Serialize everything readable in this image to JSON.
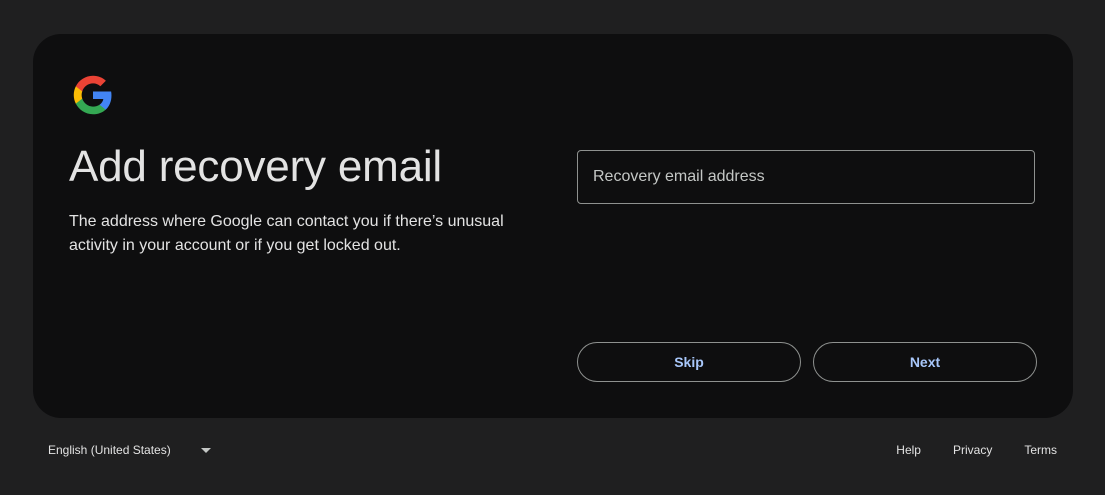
{
  "page": {
    "title": "Add recovery email",
    "subtitle": "The address where Google can contact you if there’s unusual activity in your account or if you get locked out."
  },
  "logo": {
    "icon": "google-g-logo",
    "colors": {
      "blue": "#4285F4",
      "red": "#EA4335",
      "yellow": "#FBBC05",
      "green": "#34A853"
    }
  },
  "form": {
    "email_placeholder": "Recovery email address",
    "email_value": ""
  },
  "buttons": {
    "skip_label": "Skip",
    "next_label": "Next",
    "accent_color": "#a8c7fa"
  },
  "footer": {
    "language": "English (United States)",
    "language_icon": "caret-down-icon",
    "help": "Help",
    "privacy": "Privacy",
    "terms": "Terms"
  }
}
